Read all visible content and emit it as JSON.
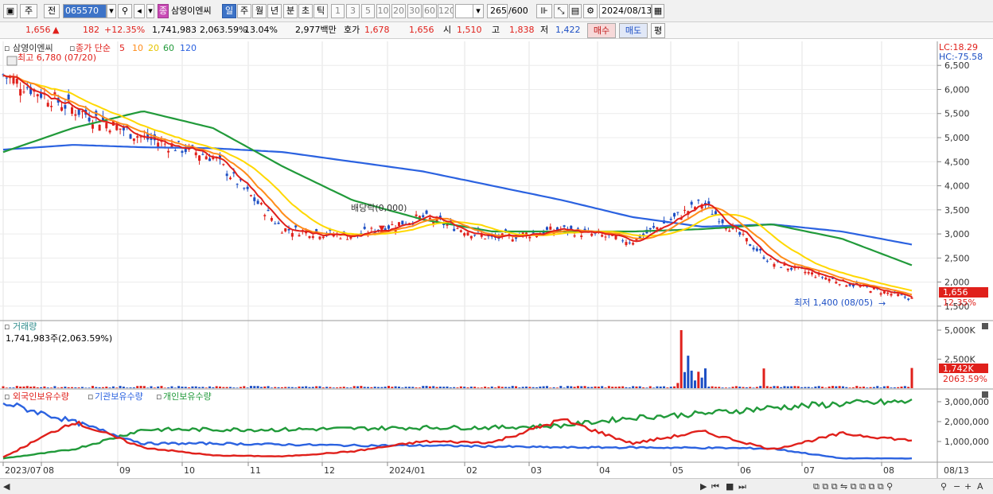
{
  "toolbar": {
    "market": "주",
    "prev": "전",
    "code": "065570",
    "stock_badge": "종",
    "stock_name": "삼영이엔씨",
    "periods": [
      "일",
      "주",
      "월",
      "년",
      "분",
      "초",
      "틱"
    ],
    "active_period": "일",
    "intervals": [
      "1",
      "3",
      "5",
      "10",
      "20",
      "30",
      "60",
      "120"
    ],
    "count": "265",
    "count_max": "/600",
    "date": "2024/08/13"
  },
  "quote": {
    "price": "1,656",
    "change_arrow": "▲",
    "change": "182",
    "change_pct": "+12.35%",
    "volume": "1,741,983",
    "volume_ratio": "2,063.59%",
    "turnover": "13.04%",
    "amount": "2,977백만",
    "ask_label": "호가",
    "ask1": "1,678",
    "ask2": "1,656",
    "open_label": "시",
    "open": "1,510",
    "high_label": "고",
    "high": "1,838",
    "low_label": "저",
    "low": "1,422",
    "buy": "매수",
    "sell": "매도",
    "eval": "평"
  },
  "price_panel": {
    "legend_name": "삼영이엔씨",
    "legend_series": "종가 단순",
    "ma_periods": [
      "5",
      "10",
      "20",
      "60",
      "120"
    ],
    "ma_colors": [
      "#e0201b",
      "#ff8c1a",
      "#ffd800",
      "#219a3a",
      "#2b62e0"
    ],
    "high_note": "최고 6,780 (07/20)",
    "low_note": "최저 1,400 (08/05)",
    "dividend_note": "배당락(0,000)",
    "lc": "LC:18.29",
    "hc": "HC:-75.58",
    "current_tag": "1,656",
    "current_pct": "12.35%",
    "y_ticks": [
      "6,500",
      "6,000",
      "5,500",
      "5,000",
      "4,500",
      "4,000",
      "3,500",
      "3,000",
      "2,500",
      "2,000",
      "1,500"
    ]
  },
  "volume_panel": {
    "title": "거래량",
    "value": "1,741,983주(2,063.59%)",
    "y_ticks": [
      "5,000K",
      "2,500K"
    ],
    "current_tag": "1,742K",
    "current_pct": "2063.59%"
  },
  "holding_panel": {
    "series": [
      "외국인보유수량",
      "기관보유수량",
      "개인보유수량"
    ],
    "colors": [
      "#e0201b",
      "#2b62e0",
      "#219a3a"
    ],
    "y_ticks": [
      "3,000,000",
      "2,000,000",
      "1,000,000"
    ]
  },
  "x_axis": {
    "labels": [
      "2023/07",
      "08",
      "09",
      "10",
      "11",
      "12",
      "2024/01",
      "02",
      "03",
      "04",
      "05",
      "06",
      "07",
      "08"
    ],
    "right_label": "08/13"
  },
  "chart_data": {
    "type": "line",
    "title": "",
    "price_range": [
      1250,
      6900
    ],
    "months": [
      "2023/07",
      "08",
      "09",
      "10",
      "11",
      "12",
      "2024/01",
      "02",
      "03",
      "04",
      "05",
      "06",
      "07",
      "08"
    ],
    "close_approx": [
      6300,
      5600,
      5000,
      4600,
      3100,
      2950,
      3350,
      2900,
      3100,
      2850,
      3650,
      2400,
      2000,
      1656
    ],
    "ma120_approx": [
      4750,
      4850,
      4800,
      4780,
      4700,
      4500,
      4300,
      4000,
      3700,
      3350,
      3150,
      3200,
      3050,
      2780
    ],
    "ma60_approx": [
      4700,
      5200,
      5550,
      5200,
      4400,
      3700,
      3300,
      3050,
      3050,
      3050,
      3100,
      3200,
      2900,
      2350
    ],
    "volume_range": [
      0,
      5000000
    ],
    "holding_range": [
      0,
      3200000
    ],
    "foreign_approx": [
      200000,
      2000000,
      700000,
      300000,
      250000,
      500000,
      1000000,
      950000,
      2100000,
      900000,
      1500000,
      600000,
      1400000,
      1050000
    ],
    "institution_approx": [
      2950000,
      2000000,
      900000,
      900000,
      850000,
      800000,
      800000,
      750000,
      700000,
      700000,
      680000,
      650000,
      150000,
      150000
    ],
    "individual_approx": [
      150000,
      600000,
      1600000,
      1600000,
      1600000,
      1650000,
      1700000,
      1700000,
      1800000,
      2200000,
      2400000,
      2700000,
      2900000,
      3000000
    ]
  }
}
